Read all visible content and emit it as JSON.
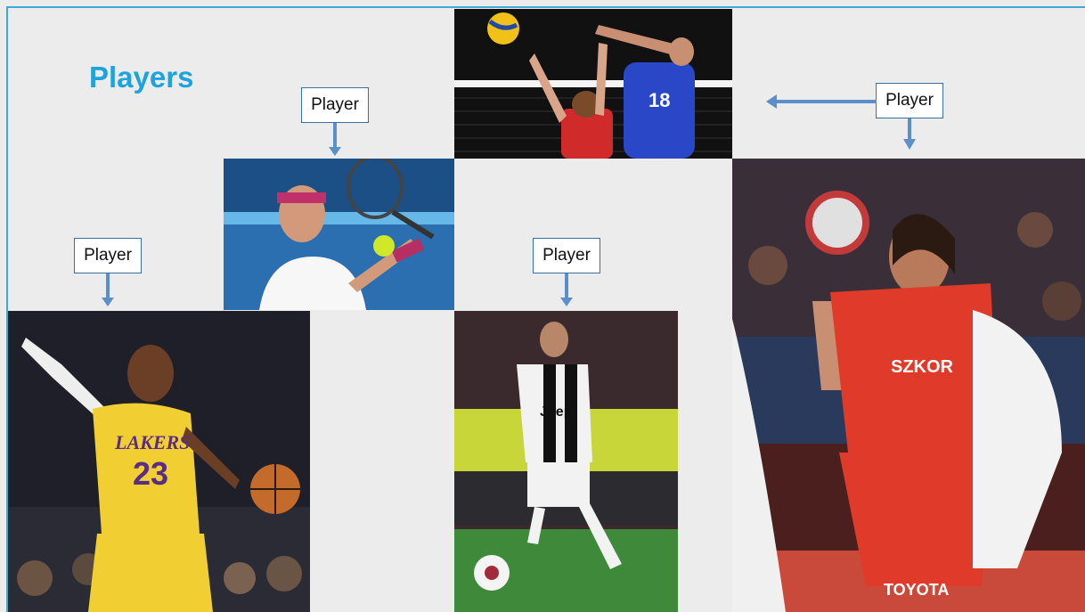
{
  "slide": {
    "title": "Players",
    "labels": [
      "Player",
      "Player",
      "Player",
      "Player"
    ]
  },
  "photos": {
    "basketball": {
      "jersey_text": "LAKERS",
      "number": "23"
    },
    "soccer": {
      "sponsor": "Jeep"
    },
    "handball": {
      "sponsor_a": "SZKOR",
      "sponsor_b": "TOYOTA"
    },
    "volleyball": {
      "number": "18"
    }
  },
  "colors": {
    "accent": "#1fa3df",
    "arrow": "#5b8fc9",
    "background": "#ececec"
  }
}
